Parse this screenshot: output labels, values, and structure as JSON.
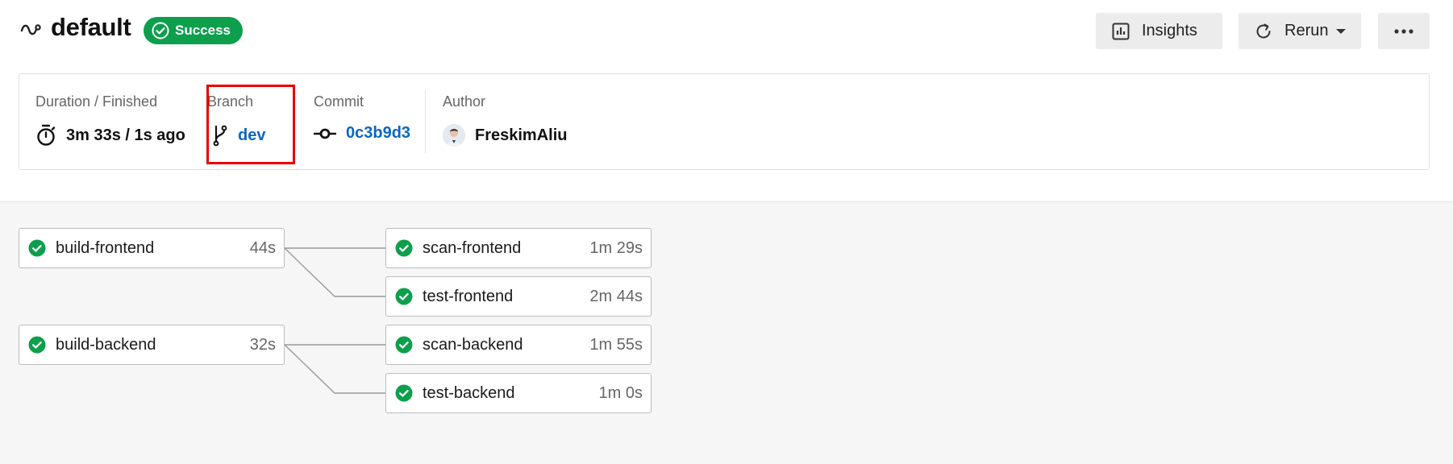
{
  "header": {
    "title": "default",
    "status": "Success",
    "insights_label": "Insights",
    "rerun_label": "Rerun",
    "more_label": "•••"
  },
  "info": {
    "duration": {
      "label": "Duration / Finished",
      "value": "3m 33s / 1s ago"
    },
    "branch": {
      "label": "Branch",
      "value": "dev"
    },
    "commit": {
      "label": "Commit",
      "value": "0c3b9d3"
    },
    "author": {
      "label": "Author",
      "value": "FreskimAliu"
    }
  },
  "jobs": {
    "build_frontend": {
      "name": "build-frontend",
      "duration": "44s"
    },
    "scan_frontend": {
      "name": "scan-frontend",
      "duration": "1m 29s"
    },
    "test_frontend": {
      "name": "test-frontend",
      "duration": "2m 44s"
    },
    "build_backend": {
      "name": "build-backend",
      "duration": "32s"
    },
    "scan_backend": {
      "name": "scan-backend",
      "duration": "1m 55s"
    },
    "test_backend": {
      "name": "test-backend",
      "duration": "1m 0s"
    }
  },
  "colors": {
    "success": "#0d9f4c",
    "link": "#0a66c2",
    "highlight": "#e80000"
  },
  "icons": {
    "pipeline": "pipeline-icon",
    "status": "check-circle-icon",
    "insights": "bar-chart-icon",
    "rerun": "refresh-icon",
    "duration": "stopwatch-icon",
    "branch": "git-branch-icon",
    "commit": "git-commit-icon",
    "author": "avatar"
  }
}
